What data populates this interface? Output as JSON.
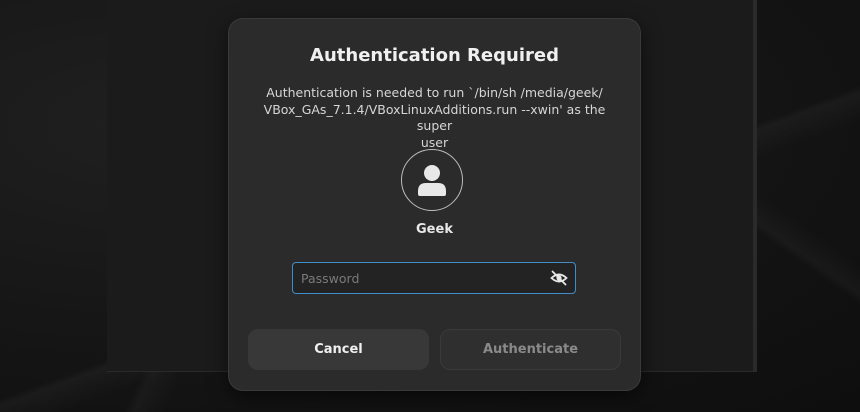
{
  "dialog": {
    "title": "Authentication Required",
    "message_line1": "Authentication is needed to run `/bin/sh /media/geek/",
    "message_line2": "VBox_GAs_7.1.4/VBoxLinuxAdditions.run --xwin' as the super",
    "message_line3": "user",
    "user": {
      "name": "Geek",
      "avatar_icon": "user-avatar-icon"
    },
    "password": {
      "placeholder": "Password",
      "value": "",
      "toggle_icon": "eye-hidden-icon"
    },
    "buttons": {
      "cancel": "Cancel",
      "authenticate": "Authenticate"
    }
  },
  "colors": {
    "dialog_bg": "#2b2b2b",
    "focus_border": "#3f8ec7",
    "cancel_bg": "#383838",
    "disabled_text": "#8a8a8a"
  }
}
